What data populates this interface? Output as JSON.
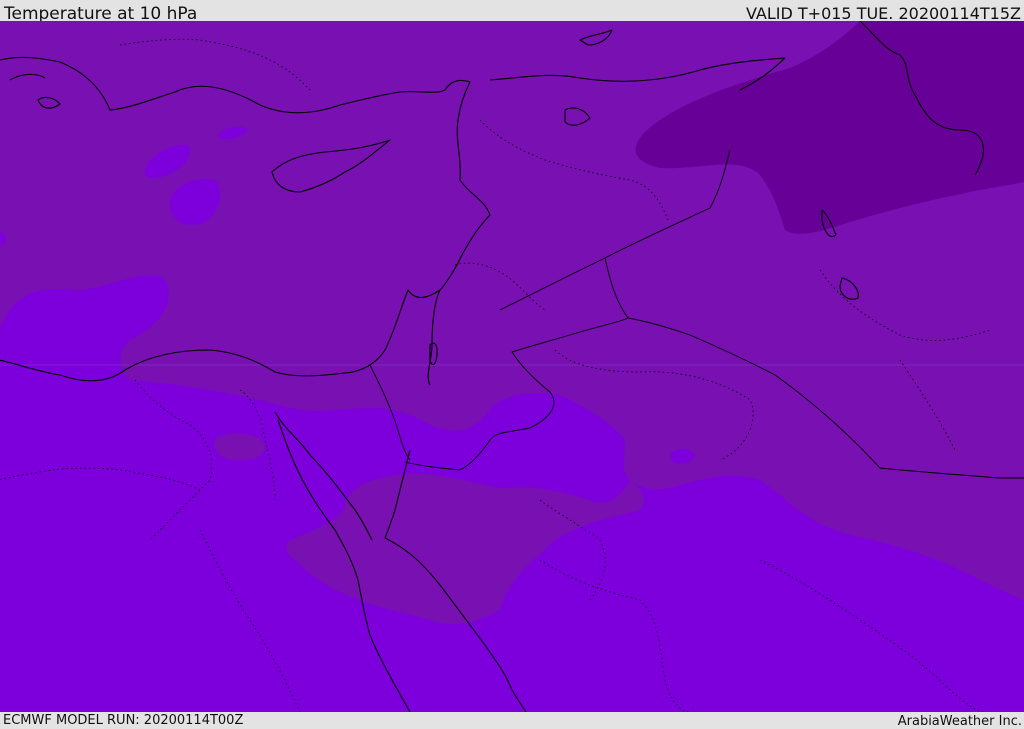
{
  "header": {
    "title": "Temperature at 10 hPa",
    "valid_time": "VALID T+015 TUE. 20200114T15Z"
  },
  "footer": {
    "model_run": "ECMWF MODEL RUN: 20200114T00Z",
    "credit": "ArabiaWeather Inc."
  },
  "map": {
    "field_colors": {
      "warm_band": "#7d00dc",
      "mid_band": "#7810b2",
      "cold_band": "#670097"
    },
    "coastline_color": "#000000",
    "border_style": "dotted"
  }
}
